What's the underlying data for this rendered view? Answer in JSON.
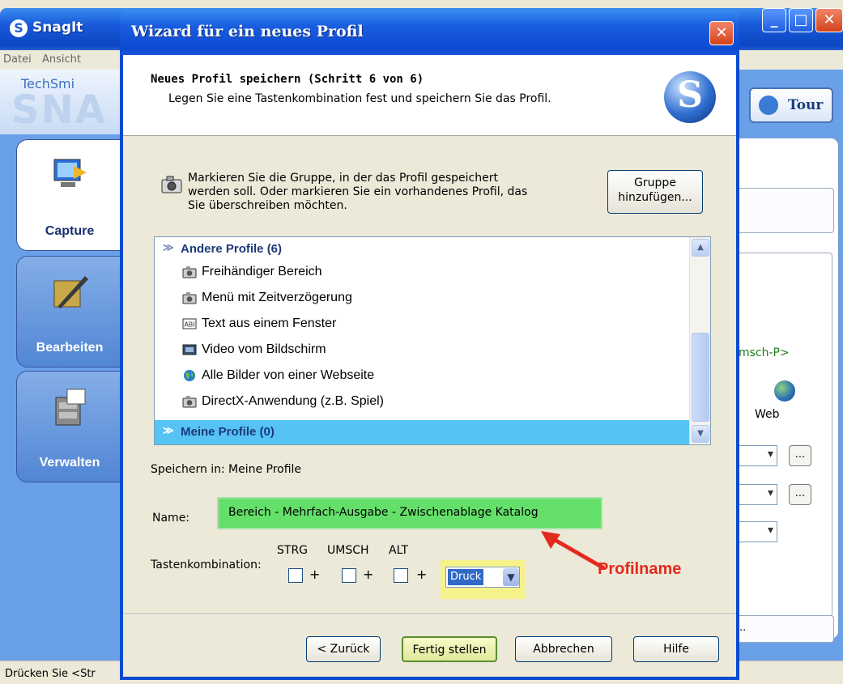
{
  "colors": {
    "xp_blue": "#0b4ad2",
    "name_field_highlight": "#64e06a",
    "selected_group": "#55c4f5",
    "annotation_red": "#e32a1d",
    "key_highlight": "#f6f28a"
  },
  "app": {
    "title": "SnagIt",
    "menu": {
      "datei": "Datei",
      "ansicht": "Ansicht"
    },
    "logo_small": "TechSmi",
    "logo_big": "SNA",
    "tabs": [
      {
        "label": "Capture",
        "icon": "capture-icon"
      },
      {
        "label": "Bearbeiten",
        "icon": "edit-icon"
      },
      {
        "label": "Verwalten",
        "icon": "manage-icon"
      }
    ],
    "tour_label": "Tour",
    "right_hotkey_text": "msch-P>",
    "right_web_label": "Web",
    "right_dots": "...",
    "right_bottom_text": "..",
    "status_text": "Drücken Sie  <Str"
  },
  "wizard": {
    "title": "Wizard für ein neues Profil",
    "heading": "Neues Profil speichern (Schritt 6 von 6)",
    "subheading": "Legen Sie eine Tastenkombination fest und speichern Sie das Profil.",
    "info_text": "Markieren Sie die Gruppe, in der das Profil gespeichert werden soll. Oder markieren Sie ein vorhandenes Profil, das Sie überschreiben möchten.",
    "gruppe_button": "Gruppe hinzufügen...",
    "groups": {
      "andere": "Andere Profile (6)",
      "meine": "Meine Profile (0)"
    },
    "profiles": [
      {
        "label": "Freihändiger Bereich",
        "icon": "camera-icon"
      },
      {
        "label": "Menü mit Zeitverzögerung",
        "icon": "camera-icon"
      },
      {
        "label": "Text aus einem Fenster",
        "icon": "text-icon"
      },
      {
        "label": "Video vom Bildschirm",
        "icon": "video-icon"
      },
      {
        "label": "Alle Bilder von einer Webseite",
        "icon": "globe-icon"
      },
      {
        "label": "DirectX-Anwendung (z.B. Spiel)",
        "icon": "camera-icon"
      }
    ],
    "speichern_label": "Speichern in:",
    "speichern_value": "Meine Profile",
    "name_label": "Name:",
    "name_value": "Bereich - Mehrfach-Ausgabe - Zwischenablage  Katalog",
    "annotation_profilname": "Profilname",
    "tasten_label": "Tastenkombination:",
    "modifiers": {
      "strg": "STRG",
      "umsch": "UMSCH",
      "alt": "ALT",
      "plus": "+"
    },
    "key_value": "Druck",
    "buttons": {
      "zurueck": "< Zurück",
      "fertig": "Fertig stellen",
      "abbrechen": "Abbrechen",
      "hilfe": "Hilfe"
    }
  }
}
